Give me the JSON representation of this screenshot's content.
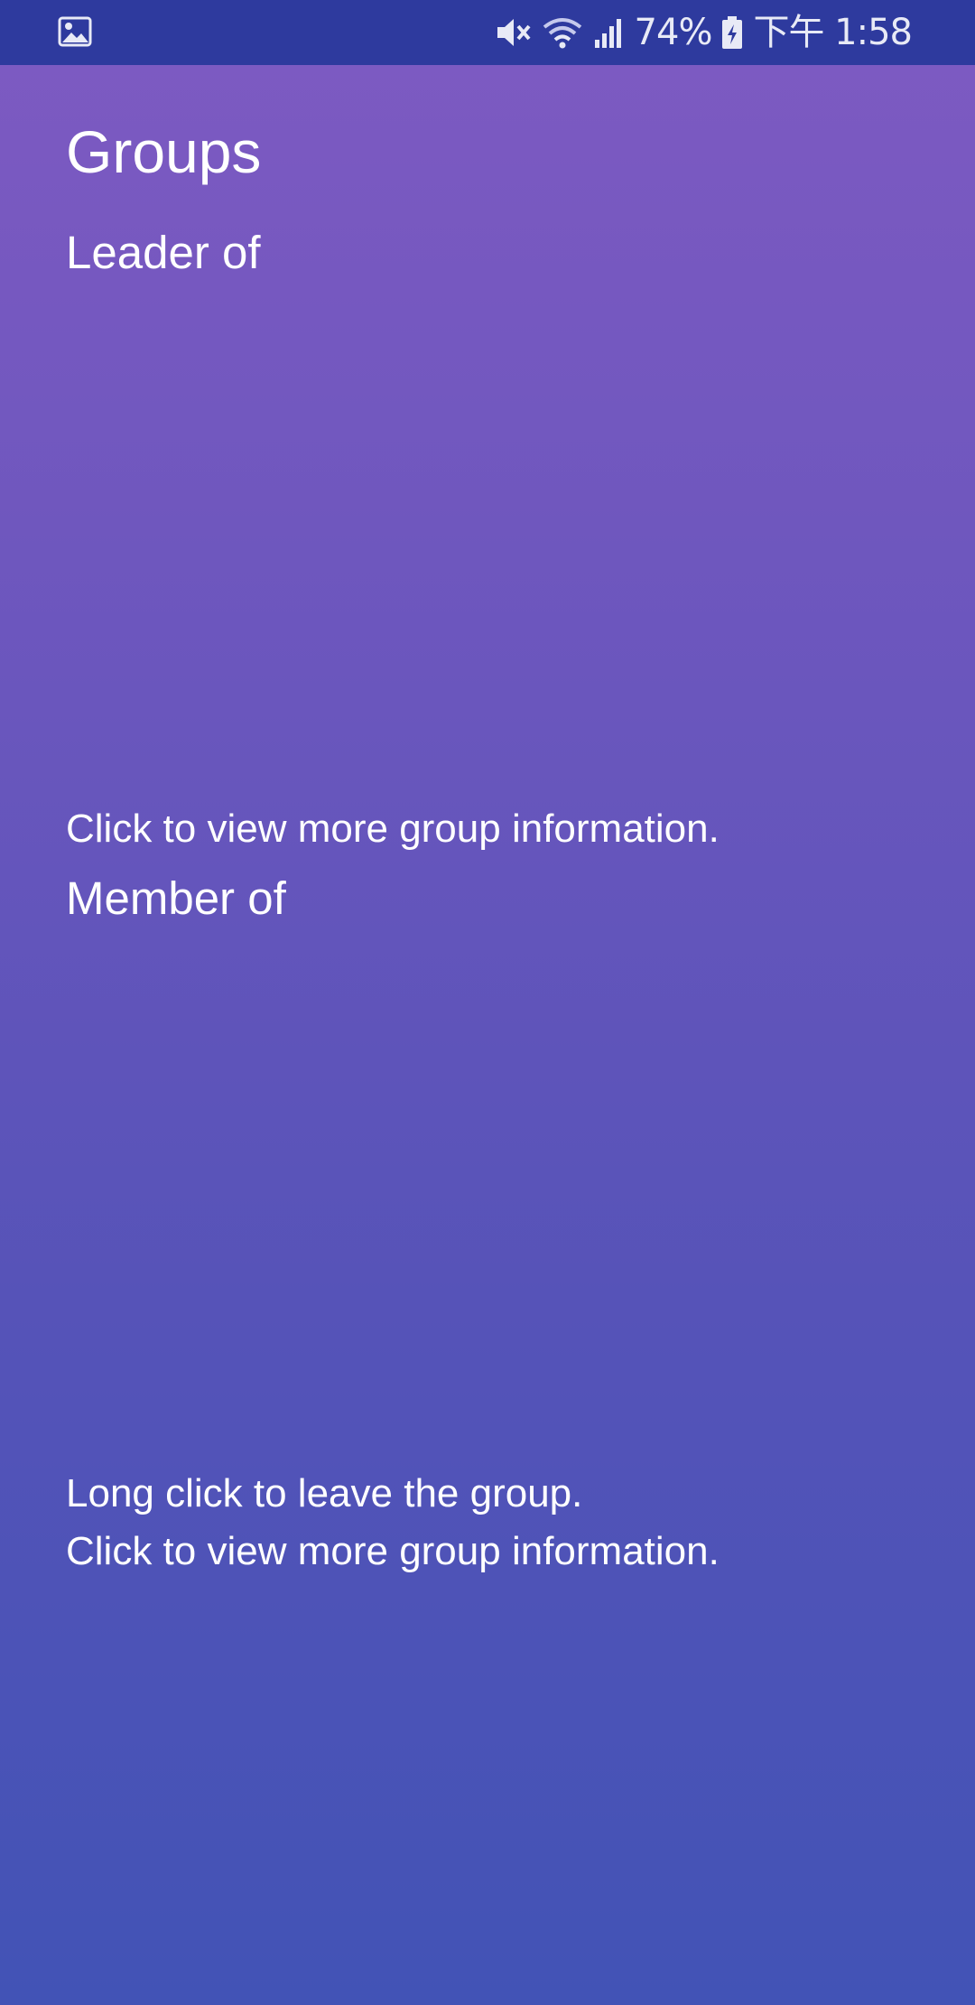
{
  "status_bar": {
    "left_icon": "image-icon",
    "icons": [
      "mute-icon",
      "wifi-icon",
      "signal-icon",
      "battery-charging-icon"
    ],
    "battery_text": "74%",
    "time": "下午 1:58",
    "background": "#2e3a9e"
  },
  "page": {
    "title": "Groups",
    "leader_section": {
      "heading": "Leader of",
      "hint": "Click to view more group information."
    },
    "member_section": {
      "heading": "Member of",
      "hint_line1": "Long click to leave the group.",
      "hint_line2": "Click to view more group information."
    },
    "gradient_colors": [
      "#7e5ac2",
      "#6a56bd",
      "#5653b8",
      "#4253b6"
    ]
  }
}
